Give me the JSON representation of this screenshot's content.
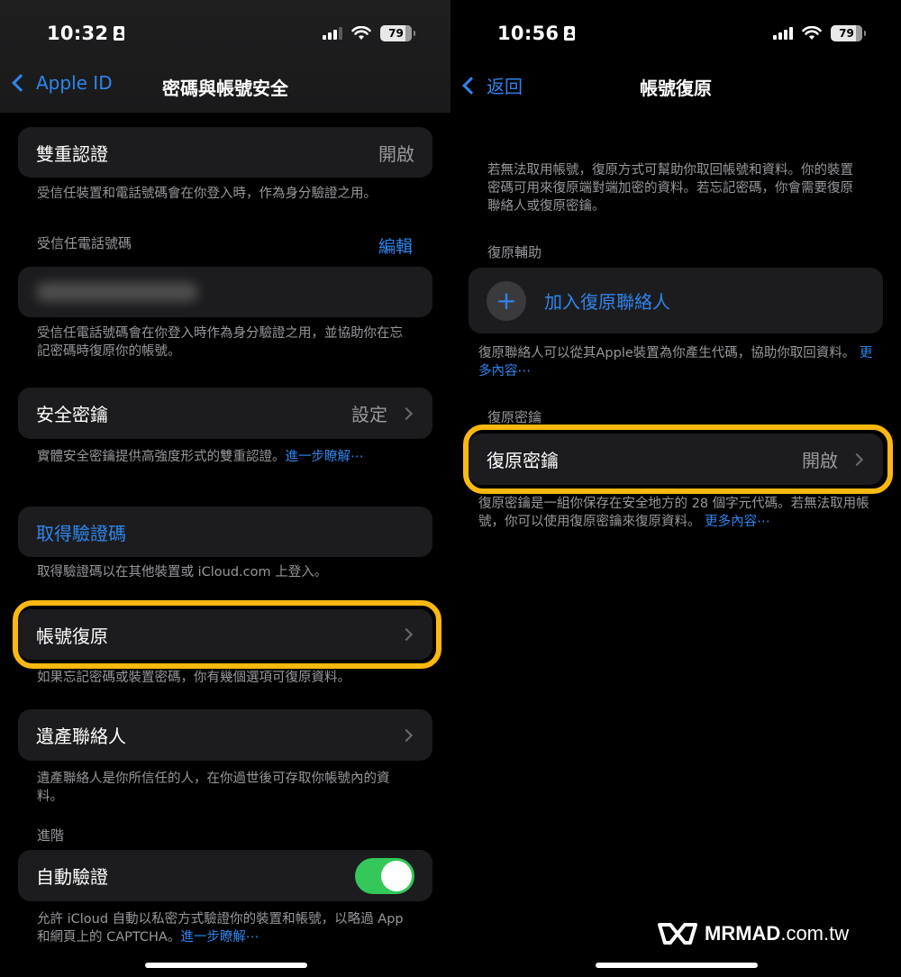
{
  "colors": {
    "accent_blue": "#2f85ec",
    "highlight_yellow": "#fbb811",
    "toggle_on": "#34c759",
    "card_bg": "#1c1c1e",
    "secondary_text": "#98989d"
  },
  "left": {
    "status": {
      "time": "10:32",
      "battery": "79"
    },
    "nav": {
      "back_label": "Apple ID",
      "title": "密碼與帳號安全"
    },
    "two_factor": {
      "label": "雙重認證",
      "value": "開啟",
      "footer": "受信任裝置和電話號碼會在你登入時，作為身分驗證之用。"
    },
    "trusted_phone": {
      "section": "受信任電話號碼",
      "edit": "編輯",
      "footer": "受信任電話號碼會在你登入時作為身分驗證之用，並協助你在忘記密碼時復原你的帳號。"
    },
    "security_keys": {
      "label": "安全密鑰",
      "value": "設定",
      "footer": "實體安全密鑰提供高強度形式的雙重認證。",
      "footer_link": "進一步瞭解⋯"
    },
    "get_code": {
      "label": "取得驗證碼",
      "footer": "取得驗證碼以在其他裝置或 iCloud.com 上登入。"
    },
    "account_recovery": {
      "label": "帳號復原",
      "footer": "如果忘記密碼或裝置密碼，你有幾個選項可復原資料。"
    },
    "legacy_contact": {
      "label": "遺產聯絡人",
      "footer": "遺產聯絡人是你所信任的人，在你過世後可存取你帳號內的資料。"
    },
    "advanced": {
      "section": "進階",
      "label": "自動驗證",
      "toggle_on": true,
      "footer": "允許 iCloud 自動以私密方式驗證你的裝置和帳號，以略過 App 和網頁上的 CAPTCHA。",
      "footer_link": "進一步瞭解⋯"
    }
  },
  "right": {
    "status": {
      "time": "10:56",
      "battery": "79"
    },
    "nav": {
      "back_label": "返回",
      "title": "帳號復原"
    },
    "intro": "若無法取用帳號，復原方式可幫助你取回帳號和資料。你的裝置密碼可用來復原端對端加密的資料。若忘記密碼，你會需要復原聯絡人或復原密鑰。",
    "recovery_assist": {
      "section": "復原輔助",
      "add_label": "加入復原聯絡人",
      "footer": "復原聯絡人可以從其Apple裝置為你產生代碼，協助你取回資料。",
      "footer_link": "更多內容⋯"
    },
    "recovery_key": {
      "section": "復原密鑰",
      "label": "復原密鑰",
      "value": "開啟",
      "footer": "復原密鑰是一組你保存在安全地方的 28 個字元代碼。若無法取用帳號，你可以使用復原密鑰來復原資料。",
      "footer_link": "更多內容⋯"
    }
  },
  "watermark": {
    "brand": "MRMAD",
    "domain": ".com.tw"
  }
}
